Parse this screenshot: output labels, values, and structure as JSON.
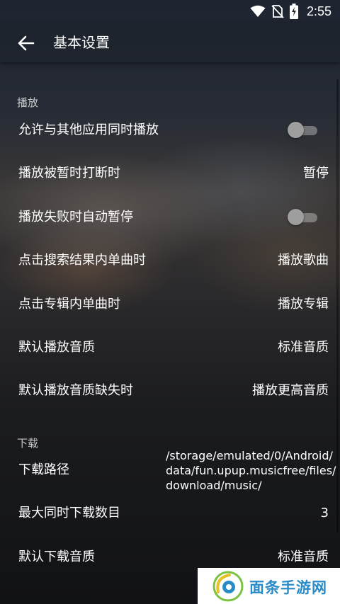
{
  "status_bar": {
    "time": "2:55",
    "icons": [
      "wifi-icon",
      "no-sim-icon",
      "battery-charging-icon"
    ]
  },
  "header": {
    "back_icon": "arrow-left-icon",
    "title": "基本设置"
  },
  "sections": {
    "playback": {
      "label": "播放",
      "rows": [
        {
          "label": "允许与其他应用同时播放",
          "type": "toggle",
          "on": false
        },
        {
          "label": "播放被暂时打断时",
          "value": "暂停"
        },
        {
          "label": "播放失败时自动暂停",
          "type": "toggle",
          "on": false
        },
        {
          "label": "点击搜索结果内单曲时",
          "value": "播放歌曲"
        },
        {
          "label": "点击专辑内单曲时",
          "value": "播放专辑"
        },
        {
          "label": "默认播放音质",
          "value": "标准音质"
        },
        {
          "label": "默认播放音质缺失时",
          "value": "播放更高音质"
        }
      ]
    },
    "download": {
      "label": "下载",
      "rows": [
        {
          "label": "下载路径",
          "value_lines": [
            "/storage/emulated/0/Android/",
            "data/fun.upup.musicfree/files/",
            "download/music/"
          ]
        },
        {
          "label": "最大同时下载数目",
          "value": "3"
        },
        {
          "label": "默认下载音质",
          "value": "标准音质"
        }
      ]
    }
  },
  "watermark": {
    "text": "面条手游网",
    "color": "#2a8bc9"
  }
}
